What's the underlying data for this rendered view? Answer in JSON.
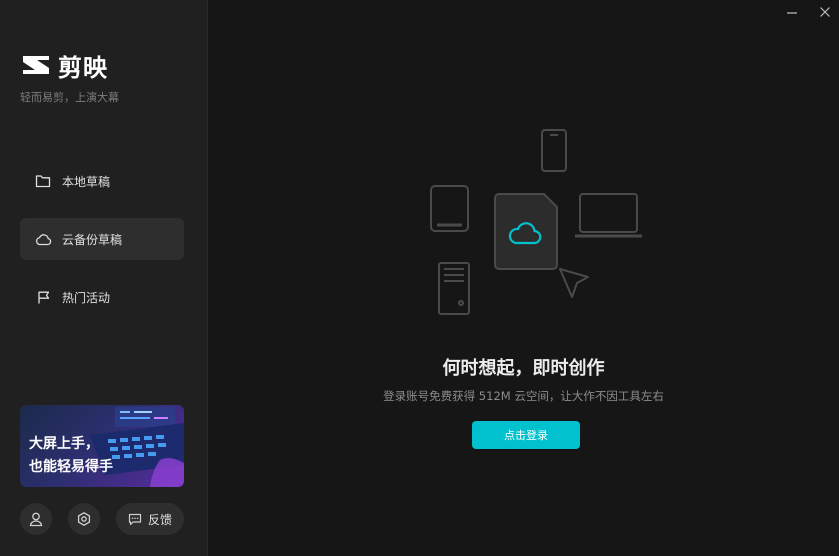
{
  "app": {
    "name": "剪映",
    "slogan": "轻而易剪，上演大幕"
  },
  "sidebar": {
    "items": [
      {
        "label": "本地草稿",
        "icon": "folder-icon",
        "active": false
      },
      {
        "label": "云备份草稿",
        "icon": "cloud-icon",
        "active": true
      },
      {
        "label": "热门活动",
        "icon": "flag-icon",
        "active": false
      }
    ],
    "banner": {
      "line1": "大屏上手，",
      "line2": "也能轻易得手"
    },
    "feedback_label": "反馈"
  },
  "main": {
    "title": "何时想起，即时创作",
    "subtitle": "登录账号免费获得 512M 云空间，让大作不因工具左右",
    "login_label": "点击登录"
  },
  "colors": {
    "accent": "#00c1cd",
    "background": "#161616",
    "sidebar": "#202020"
  }
}
